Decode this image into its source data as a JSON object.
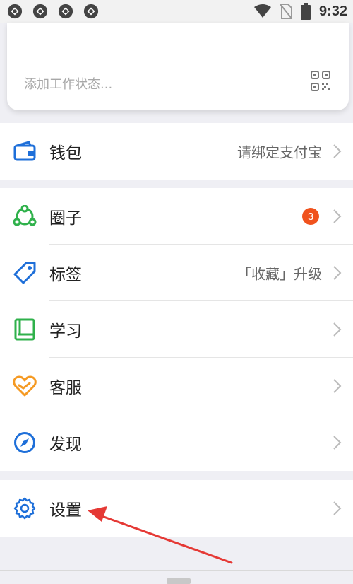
{
  "status_bar": {
    "time": "9:32",
    "app_icons": [
      "app-icon",
      "app-icon",
      "app-icon",
      "app-icon"
    ],
    "system_icons": [
      "wifi-icon",
      "no-sim-icon",
      "battery-icon"
    ]
  },
  "work_status": {
    "placeholder": "添加工作状态...",
    "qr_icon": "qr-code-icon"
  },
  "menu": {
    "wallet": {
      "label": "钱包",
      "value": "请绑定支付宝",
      "icon": "wallet-icon"
    },
    "circle": {
      "label": "圈子",
      "badge": "3",
      "icon": "circle-group-icon"
    },
    "tags": {
      "label": "标签",
      "value": "「收藏」升级",
      "icon": "tag-icon"
    },
    "study": {
      "label": "学习",
      "icon": "book-icon"
    },
    "service": {
      "label": "客服",
      "icon": "heart-service-icon"
    },
    "discover": {
      "label": "发现",
      "icon": "compass-icon"
    },
    "settings": {
      "label": "设置",
      "icon": "gear-icon"
    }
  },
  "colors": {
    "blue": "#1e6fd9",
    "green": "#2fb14b",
    "orange": "#f59a23",
    "badge": "#f0521d",
    "annotation_arrow": "#e53935"
  }
}
